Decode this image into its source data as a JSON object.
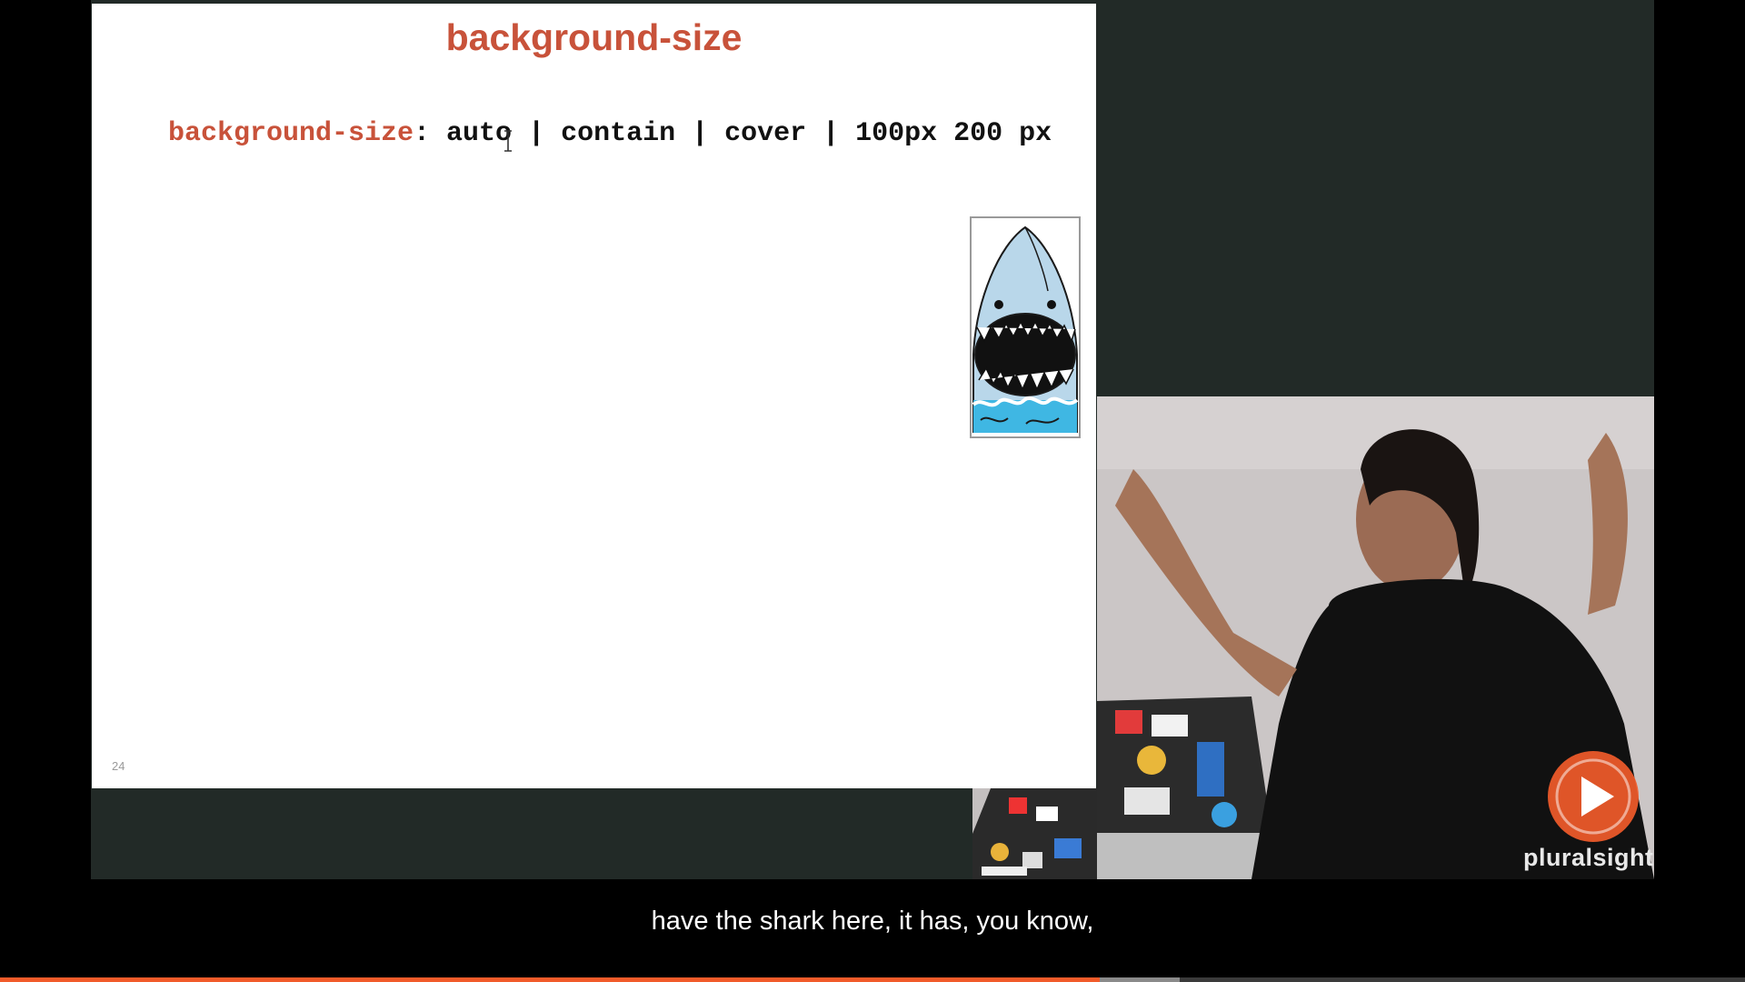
{
  "slide": {
    "title": "background-size",
    "code_property": "background-size",
    "code_values": ": auto | contain | cover | 100px 200 px",
    "number": "24"
  },
  "subtitle": "have the shark here, it has, you know,",
  "logo": {
    "text": "pluralsight",
    "icon": "play-icon",
    "color": "#f15b2a"
  },
  "player": {
    "progress": 0.63,
    "buffered": 0.676,
    "accent": "#f15b2a"
  },
  "colors": {
    "title": "#c8523a",
    "frame": "#222a27"
  }
}
